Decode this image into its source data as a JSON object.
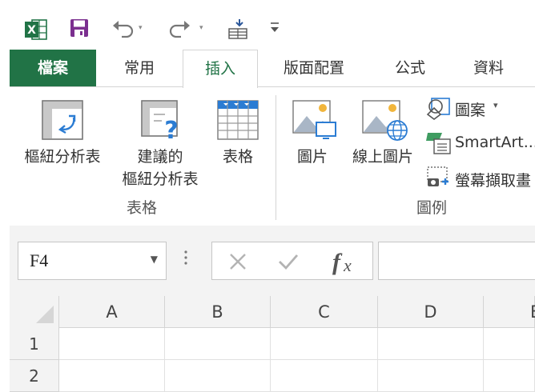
{
  "qat": {
    "undo_dropdown": "▾",
    "redo_dropdown": "▾",
    "more": "▾"
  },
  "tabs": [
    {
      "label": "檔案"
    },
    {
      "label": "常用"
    },
    {
      "label": "插入"
    },
    {
      "label": "版面配置"
    },
    {
      "label": "公式"
    },
    {
      "label": "資料"
    }
  ],
  "ribbon": {
    "groups": {
      "tables": {
        "label": "表格",
        "pivot_table": "樞紐分析表",
        "recommended_line1": "建議的",
        "recommended_line2": "樞紐分析表",
        "table": "表格"
      },
      "illustrations": {
        "label": "圖例",
        "pictures": "圖片",
        "online_pictures": "線上圖片",
        "shapes": "圖案",
        "shapes_dd": "▾",
        "smartart": "SmartArt...",
        "screenshot": "螢幕擷取畫"
      }
    }
  },
  "formula_bar": {
    "name_box": "F4",
    "name_box_dd": "▼",
    "formula_value": ""
  },
  "grid": {
    "columns": [
      "A",
      "B",
      "C",
      "D",
      "E"
    ],
    "rows": [
      "1",
      "2"
    ]
  },
  "colors": {
    "accent": "#217346",
    "file_tab": "#217346"
  }
}
